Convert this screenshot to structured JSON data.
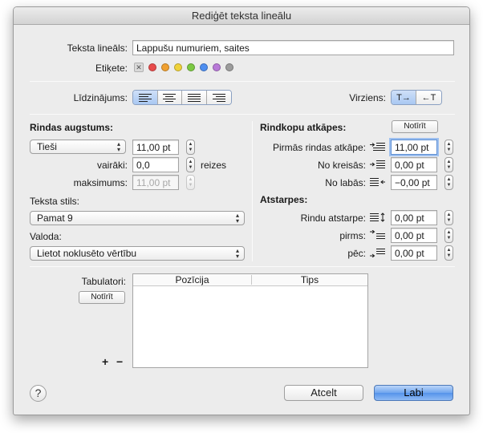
{
  "window": {
    "title": "Rediģēt teksta lineālu"
  },
  "ruler": {
    "name_label": "Teksta lineāls:",
    "name_value": "Lappušu numuriem, saites",
    "tag_label": "Etiķete:",
    "tag_colors": [
      "#e84b4b",
      "#f0a030",
      "#efd23a",
      "#7cc943",
      "#4e8ef0",
      "#b879d8",
      "#9c9c9c"
    ]
  },
  "alignment": {
    "label": "Līdzinājums:",
    "options": [
      "align-left-icon",
      "align-center-icon",
      "align-justify-icon",
      "align-right-icon"
    ],
    "selected": "align-left-icon"
  },
  "direction": {
    "label": "Virziens:",
    "ltr": "T→",
    "rtl": "←T",
    "selected": "ltr"
  },
  "line_height": {
    "heading": "Rindas augstums:",
    "mode": "Tieši",
    "value": "11,00 pt",
    "multiple_label": "vairāki:",
    "multiple_value": "0,0",
    "multiple_unit": "reizes",
    "max_label": "maksimums:",
    "max_value": "11,00 pt"
  },
  "text_style": {
    "label": "Teksta stils:",
    "value": "Pamat 9"
  },
  "language": {
    "label": "Valoda:",
    "value": "Lietot noklusēto vērtību"
  },
  "indents": {
    "heading": "Rindkopu atkāpes:",
    "clear_label": "Notīrīt",
    "first_line_label": "Pirmās rindas atkāpe:",
    "first_line_value": "11,00 pt",
    "left_label": "No kreisās:",
    "left_value": "0,00 pt",
    "right_label": "No labās:",
    "right_value": "−0,00 pt"
  },
  "spacing": {
    "heading": "Atstarpes:",
    "line_label": "Rindu atstarpe:",
    "line_value": "0,00 pt",
    "before_label": "pirms:",
    "before_value": "0,00 pt",
    "after_label": "pēc:",
    "after_value": "0,00 pt"
  },
  "tabs": {
    "label": "Tabulatori:",
    "clear_label": "Notīrīt",
    "col_position": "Pozīcija",
    "col_type": "Tips",
    "add": "+",
    "remove": "−"
  },
  "footer": {
    "help": "?",
    "cancel": "Atcelt",
    "ok": "Labi"
  }
}
